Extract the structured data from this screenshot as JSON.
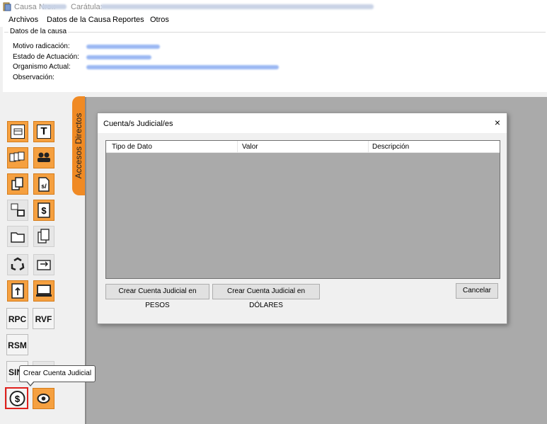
{
  "window": {
    "causa_label": "Causa Nro.:",
    "caratula_label": "Carátula:"
  },
  "menu": [
    "Archivos",
    "Datos de la Causa",
    "Reportes",
    "Otros"
  ],
  "datos_causa": {
    "legend": "Datos de la causa",
    "fields": [
      "Motivo radicación:",
      "Estado de Actuación:",
      "Organismo Actual:",
      "Observación:"
    ]
  },
  "side_tab": {
    "label": "Accesos Directos",
    "color": "#f08a24"
  },
  "shortcuts": {
    "rpc": "RPC",
    "rvf": "RVF",
    "rsm": "RSM",
    "sin": "SIN",
    "tooltip": "Crear Cuenta Judicial"
  },
  "dialog": {
    "title": "Cuenta/s Judicial/es",
    "close_glyph": "×",
    "columns": [
      "Tipo de Dato",
      "Valor",
      "Descripción"
    ],
    "buttons": {
      "pesos": "Crear Cuenta Judicial en PESOS",
      "dolares": "Crear Cuenta Judicial en DÓLARES",
      "cancel": "Cancelar"
    }
  },
  "icons": {
    "app": "app-icon",
    "calendar": "calendar-icon",
    "t": "t-icon",
    "pages": "pages-icon",
    "people": "people-icon",
    "copy": "copy-icon",
    "sdoc": "s-document-icon",
    "windows": "windows-icon",
    "dollar_doc": "dollar-document-icon",
    "folder": "folder-icon",
    "docs": "documents-icon",
    "recycle": "recycle-icon",
    "transfer": "transfer-icon",
    "upload": "upload-icon",
    "monitor": "monitor-icon",
    "dollar_circle": "dollar-circle-icon",
    "eye": "eye-icon"
  }
}
